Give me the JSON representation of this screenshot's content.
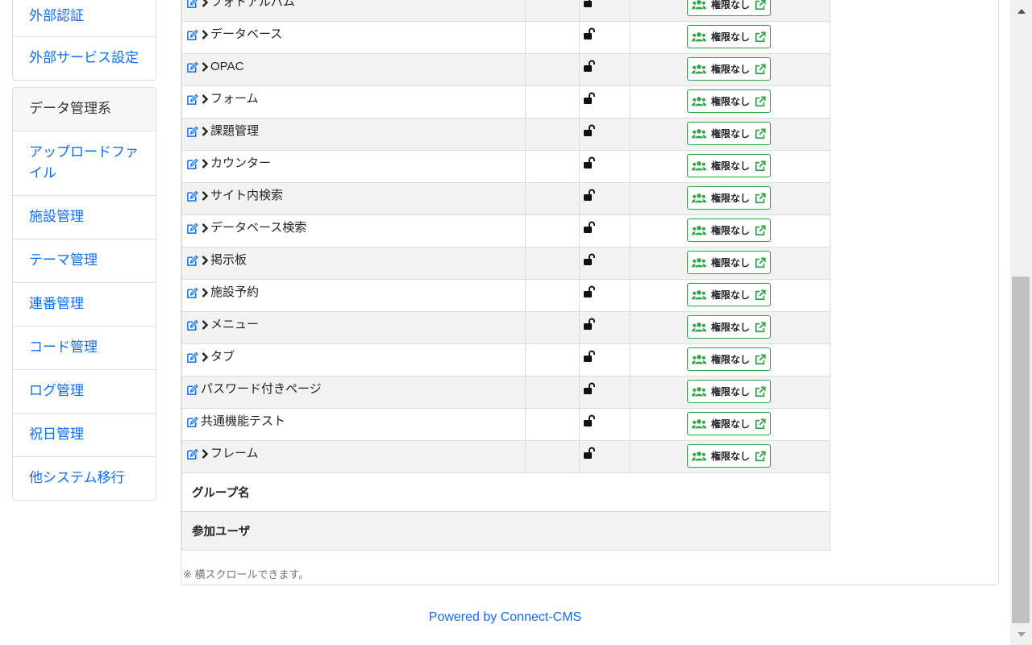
{
  "sidebar": {
    "group1": [
      "外部認証",
      "外部サービス設定"
    ],
    "group2_header": "データ管理系",
    "group2": [
      "アップロードファイル",
      "施設管理",
      "テーマ管理",
      "連番管理",
      "コード管理",
      "ログ管理",
      "祝日管理",
      "他システム移行"
    ]
  },
  "table": {
    "rows": [
      {
        "name": "フォトアルバム",
        "chevron": true
      },
      {
        "name": "データベース",
        "chevron": true
      },
      {
        "name": "OPAC",
        "chevron": true
      },
      {
        "name": "フォーム",
        "chevron": true
      },
      {
        "name": "課題管理",
        "chevron": true
      },
      {
        "name": "カウンター",
        "chevron": true
      },
      {
        "name": "サイト内検索",
        "chevron": true
      },
      {
        "name": "データベース検索",
        "chevron": true
      },
      {
        "name": "掲示板",
        "chevron": true
      },
      {
        "name": "施設予約",
        "chevron": true
      },
      {
        "name": "メニュー",
        "chevron": true
      },
      {
        "name": "タブ",
        "chevron": true
      },
      {
        "name": "パスワード付きページ",
        "chevron": false
      },
      {
        "name": "共通機能テスト",
        "chevron": false
      },
      {
        "name": "フレーム",
        "chevron": true
      }
    ],
    "permission_button_label": "権限なし",
    "group_name_label": "グループ名",
    "members_label": "参加ユーザ"
  },
  "scroll_note": "※ 横スクロールできます。",
  "footer": {
    "powered_by": "Powered by Connect-CMS"
  },
  "icons": {
    "edit": "edit-icon",
    "chevron": "chevron-right-icon",
    "lock": "unlock-icon",
    "users": "users-icon",
    "external": "external-link-icon"
  },
  "colors": {
    "link": "#0d6efd",
    "success": "#28a745"
  }
}
